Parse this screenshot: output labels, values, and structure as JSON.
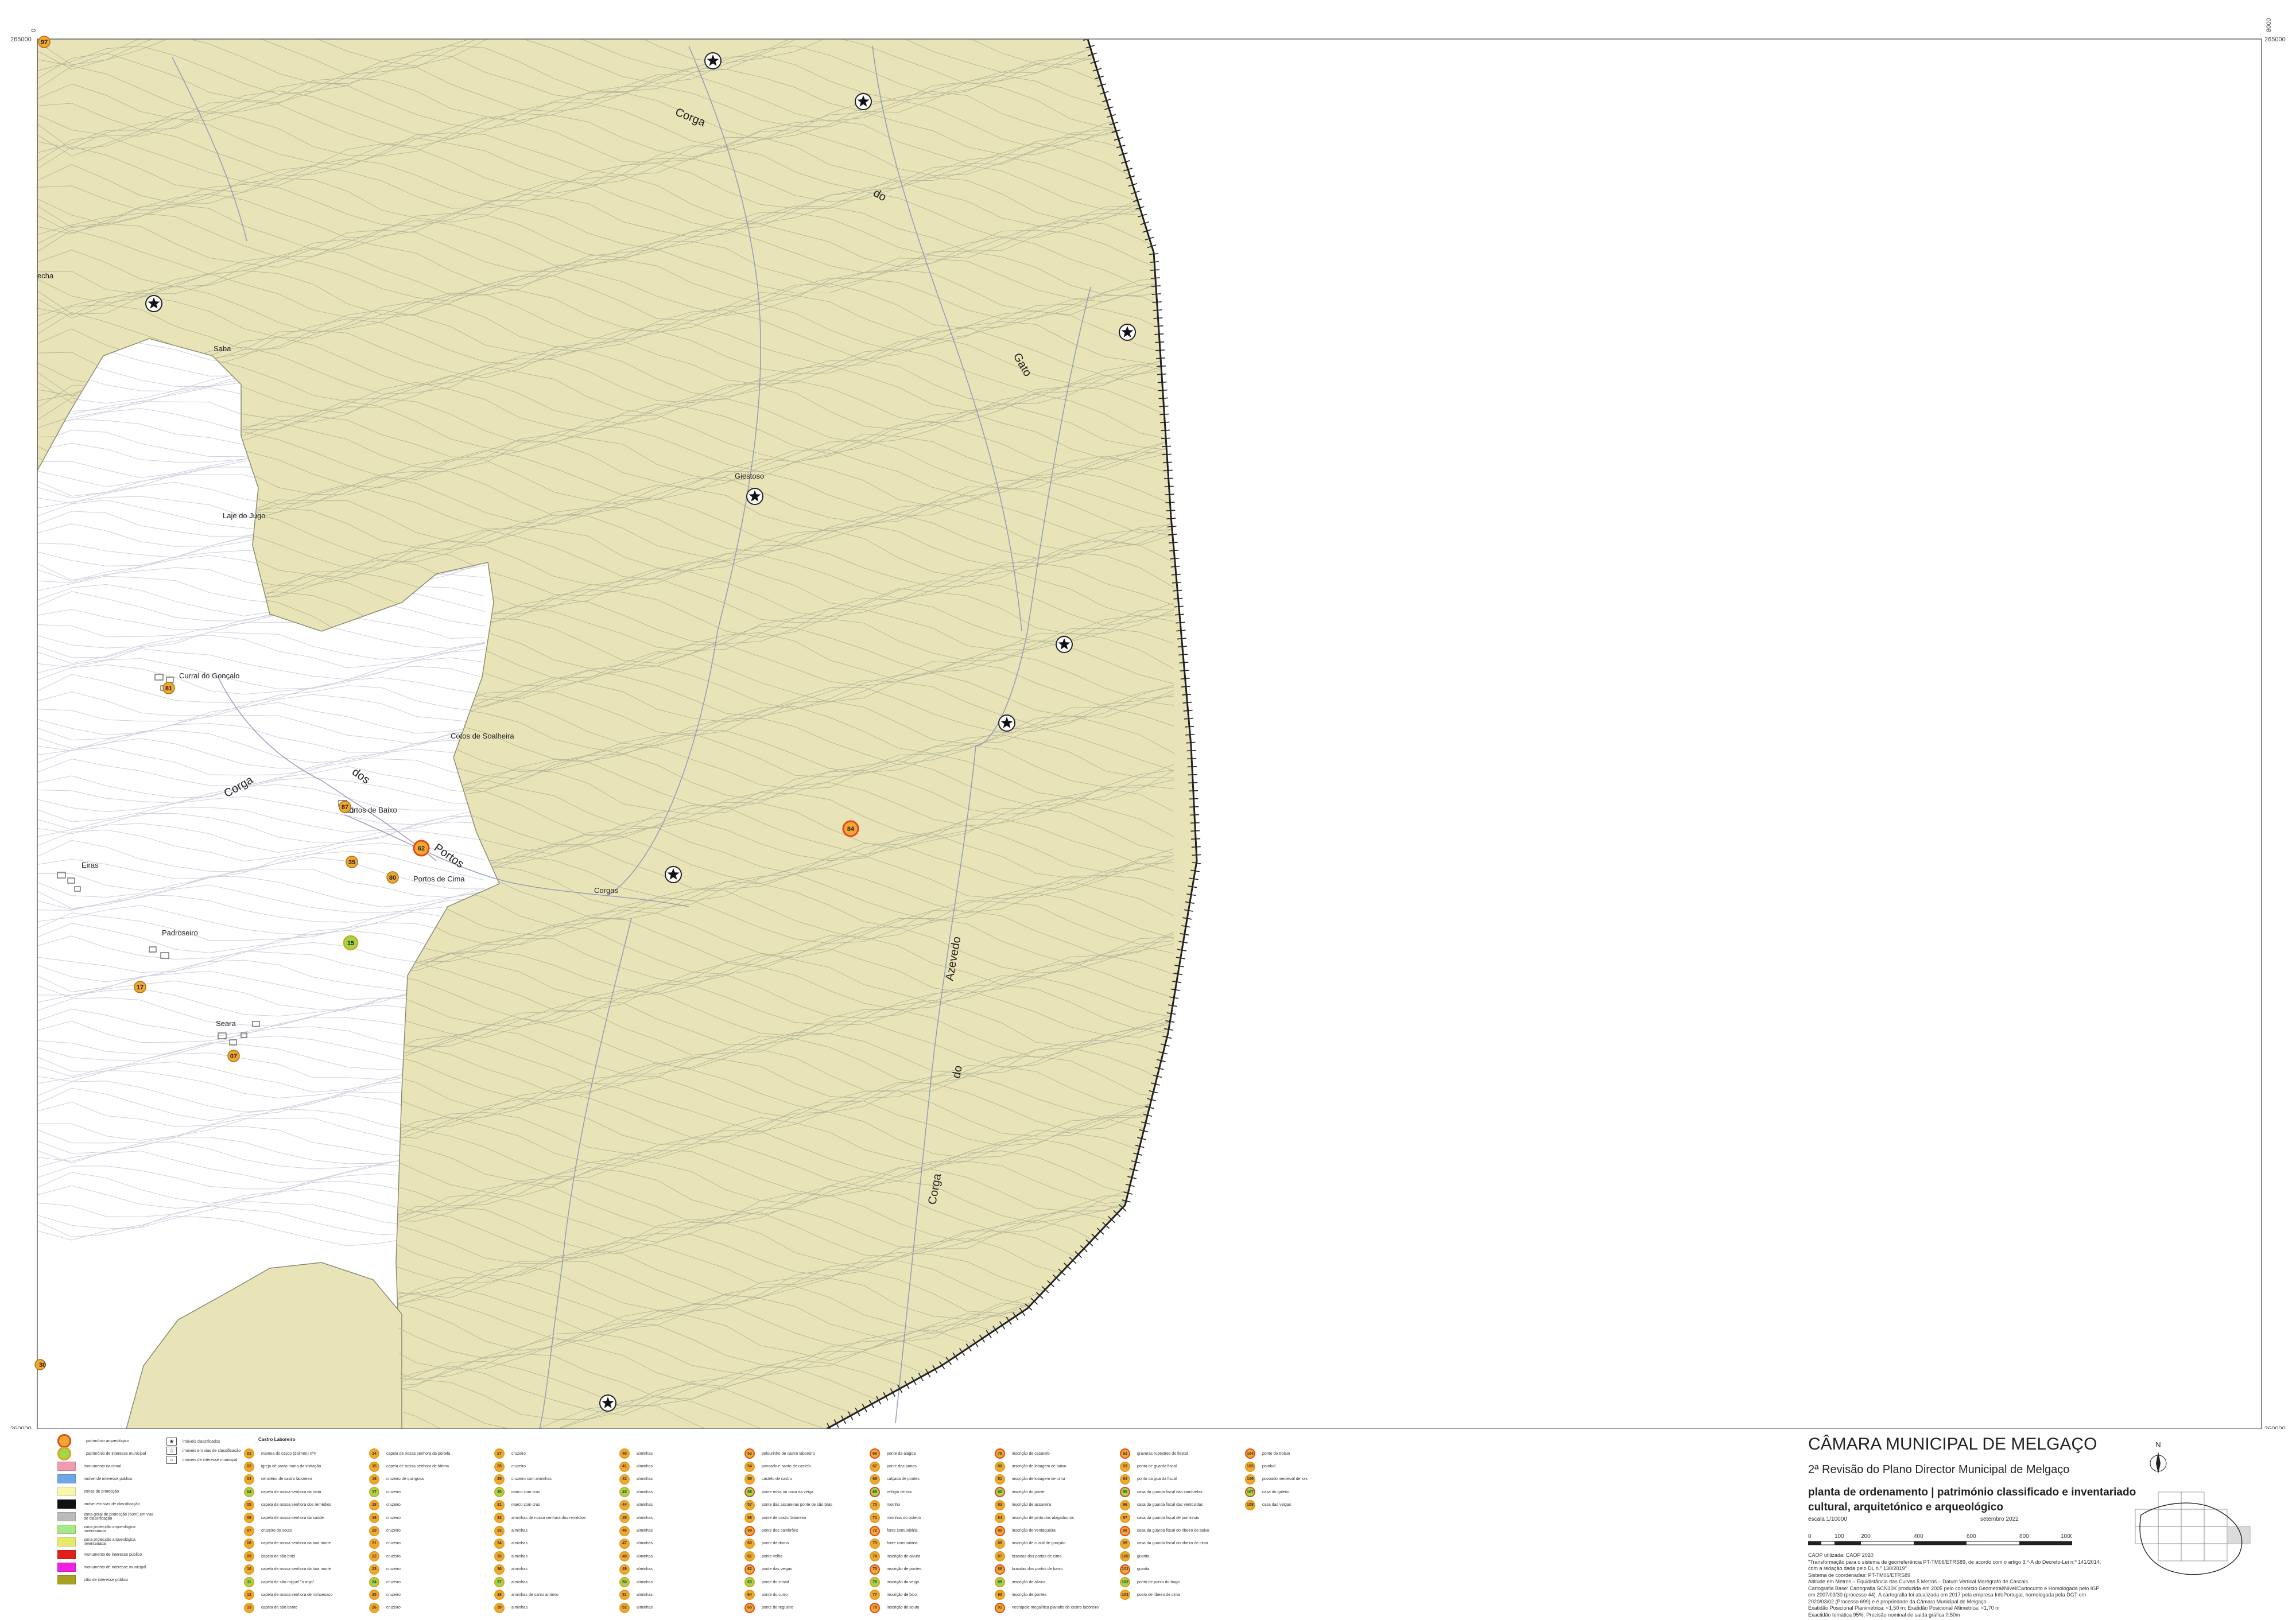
{
  "map": {
    "coords": {
      "top_left": "265000",
      "top_right": "265000",
      "bottom_left": "260000",
      "bottom_right": "260000",
      "top_small_left": "0",
      "top_small_right": "8000",
      "bottom_small_right": "8000"
    },
    "place_names": {
      "saba": "Saba",
      "lage_do_jugo": "Laje do Jugo",
      "giestoso": "Giestoso",
      "curral_goncalo": "Curral do Gonçalo",
      "cotos_soalheira": "Cotos de Soalheira",
      "portos_baixo": "Portos de Baixo",
      "portos_cima": "Portos de Cima",
      "eiras": "Eiras",
      "padroseiro": "Padroseiro",
      "seara": "Seara",
      "corgas": "Corgas",
      "echa": "echa"
    },
    "stream_names": {
      "corga_top": "Corga",
      "do_top": "do",
      "gato": "Gato",
      "corga_dos": "Corga",
      "dos": "dos",
      "portos": "Portos",
      "azevedo": "Azevedo",
      "do_bottom": "do",
      "corga_bottom": "Corga"
    },
    "poi_numbers": {
      "p97": "97",
      "p81": "81",
      "p87": "87",
      "p62": "62",
      "p84": "84",
      "p35": "35",
      "p80": "80",
      "p15": "15",
      "p17": "17",
      "p07": "07",
      "p30": "30"
    },
    "colors": {
      "zone_fill": "#e9e4b8",
      "contour": "#b7b89a",
      "border": "#222222",
      "poi_orange": "#f0a830",
      "poi_ring": "#e24a1a",
      "poi_green": "#9fd84a"
    }
  },
  "legend": {
    "left": [
      {
        "label": "património arqueológico",
        "color": "#f0a830",
        "shape": "circle"
      },
      {
        "label": "património de interesse municipal",
        "color": "#9fd84a",
        "shape": "circle"
      },
      {
        "label": "monumento nacional",
        "color": "#f29ab0",
        "shape": "rect"
      },
      {
        "label": "imóvel de interesse público",
        "color": "#6ea8e6",
        "shape": "rect"
      },
      {
        "label": "zonas de protecção",
        "color": "#f7f7b0",
        "shape": "rect"
      },
      {
        "label": "imóvel em vias de classificação",
        "color": "#111111",
        "shape": "rect"
      },
      {
        "label": "zona geral de protecção (50m) em vias de classificação",
        "color": "#bbbbbb",
        "shape": "rect"
      },
      {
        "label": "zona protecção arqueológica inventariada",
        "color": "#a8e68a",
        "shape": "rect"
      },
      {
        "label": "zona protecção arqueológica inventariada",
        "color": "#e8e86a",
        "shape": "rect"
      },
      {
        "label": "monumento de interesse público",
        "color": "#e0201a",
        "shape": "rect"
      },
      {
        "label": "monumento de interesse municipal",
        "color": "#f020e0",
        "shape": "rect"
      },
      {
        "label": "sítio de interesse público",
        "color": "#a8a020",
        "shape": "rect"
      }
    ],
    "small": [
      {
        "label": "imóveis classificados",
        "glyph": "★"
      },
      {
        "label": "imóveis em vias de classificação",
        "glyph": "☆"
      },
      {
        "label": "imóveis de interesse municipal",
        "glyph": "○"
      }
    ],
    "title": "Castro Laboreiro",
    "columns": [
      [
        {
          "n": "01",
          "t": "mamoa do casco (dolmen) nº4"
        },
        {
          "n": "02",
          "t": "igreja de santa maria da visitação"
        },
        {
          "n": "03",
          "t": "cemitério de castro laboreiro"
        },
        {
          "n": "04",
          "t": "capela de nossa senhora da vista"
        },
        {
          "n": "05",
          "t": "capela de nossa senhora dos remédios"
        },
        {
          "n": "06",
          "t": "capela de nossa senhora da saúde"
        },
        {
          "n": "07",
          "t": "cruzeiro do souto"
        },
        {
          "n": "08",
          "t": "capela de nossa senhora da boa morte"
        },
        {
          "n": "09",
          "t": "capela de são brás"
        },
        {
          "n": "10",
          "t": "capela de nossa senhora da boa morte"
        },
        {
          "n": "11",
          "t": "capela de são miguel \"o anjo\""
        },
        {
          "n": "12",
          "t": "capela de nossa senhora de rompesaco"
        },
        {
          "n": "13",
          "t": "capela de são bento"
        }
      ],
      [
        {
          "n": "14",
          "t": "capela de nossa senhora da portela"
        },
        {
          "n": "15",
          "t": "capela de nossa senhora de fátima"
        },
        {
          "n": "16",
          "t": "cruzeiro de quingosa"
        },
        {
          "n": "17",
          "t": "cruzeiro"
        },
        {
          "n": "18",
          "t": "cruzeiro"
        },
        {
          "n": "19",
          "t": "cruzeiro"
        },
        {
          "n": "20",
          "t": "cruzeiro"
        },
        {
          "n": "21",
          "t": "cruzeiro"
        },
        {
          "n": "22",
          "t": "cruzeiro"
        },
        {
          "n": "23",
          "t": "cruzeiro"
        },
        {
          "n": "24",
          "t": "cruzeiro"
        },
        {
          "n": "25",
          "t": "cruzeiro"
        },
        {
          "n": "26",
          "t": "cruzeiro"
        }
      ],
      [
        {
          "n": "27",
          "t": "cruzeiro"
        },
        {
          "n": "28",
          "t": "cruzeiro"
        },
        {
          "n": "29",
          "t": "cruzeiro com alminhas"
        },
        {
          "n": "30",
          "t": "marco com cruz"
        },
        {
          "n": "31",
          "t": "marco com cruz"
        },
        {
          "n": "32",
          "t": "alminhas de nossa senhora dos remédios"
        },
        {
          "n": "33",
          "t": "alminhas"
        },
        {
          "n": "34",
          "t": "alminhas"
        },
        {
          "n": "35",
          "t": "alminhas"
        },
        {
          "n": "36",
          "t": "alminhas"
        },
        {
          "n": "37",
          "t": "alminhas"
        },
        {
          "n": "38",
          "t": "alminhas de santo antónio"
        },
        {
          "n": "39",
          "t": "alminhas"
        }
      ],
      [
        {
          "n": "40",
          "t": "alminhas"
        },
        {
          "n": "41",
          "t": "alminhas"
        },
        {
          "n": "42",
          "t": "alminhas"
        },
        {
          "n": "43",
          "t": "alminhas"
        },
        {
          "n": "44",
          "t": "alminhas"
        },
        {
          "n": "45",
          "t": "alminhas"
        },
        {
          "n": "46",
          "t": "alminhas"
        },
        {
          "n": "47",
          "t": "alminhas"
        },
        {
          "n": "48",
          "t": "alminhas"
        },
        {
          "n": "49",
          "t": "alminhas"
        },
        {
          "n": "50",
          "t": "alminhas"
        },
        {
          "n": "51",
          "t": "alminhas"
        },
        {
          "n": "52",
          "t": "alminhas"
        }
      ],
      [
        {
          "n": "53",
          "t": "pelourinho de castro laboreiro"
        },
        {
          "n": "54",
          "t": "povoado e santo de castelo"
        },
        {
          "n": "55",
          "t": "castelo de castro"
        },
        {
          "n": "56",
          "t": "ponte nova ou nova da veiga"
        },
        {
          "n": "57",
          "t": "ponte das assureiras ponte de são brás"
        },
        {
          "n": "58",
          "t": "ponte de castro laboreiro"
        },
        {
          "n": "59",
          "t": "ponte dos cambrões"
        },
        {
          "n": "60",
          "t": "ponte da dorna"
        },
        {
          "n": "61",
          "t": "ponte velha"
        },
        {
          "n": "62",
          "t": "ponte das veigas"
        },
        {
          "n": "63",
          "t": "ponte do cristal"
        },
        {
          "n": "64",
          "t": "ponte do curro"
        },
        {
          "n": "65",
          "t": "ponte do regueiro"
        }
      ],
      [
        {
          "n": "66",
          "t": "ponte da alagoa"
        },
        {
          "n": "67",
          "t": "ponte das porias"
        },
        {
          "n": "68",
          "t": "calçada de pontes"
        },
        {
          "n": "69",
          "t": "refúgio de xxx"
        },
        {
          "n": "70",
          "t": "moinho"
        },
        {
          "n": "71",
          "t": "moinhos do outeiro"
        },
        {
          "n": "72",
          "t": "fonte comunitária"
        },
        {
          "n": "73",
          "t": "fonte comunitária"
        },
        {
          "n": "74",
          "t": "inscrição de alvura"
        },
        {
          "n": "75",
          "t": "inscrição de pontes"
        },
        {
          "n": "76",
          "t": "inscrição da veiga"
        },
        {
          "n": "77",
          "t": "inscrição de bico"
        },
        {
          "n": "78",
          "t": "inscrição do souto"
        }
      ],
      [
        {
          "n": "79",
          "t": "inscrição de casarelo"
        },
        {
          "n": "80",
          "t": "inscrição de lobagem de baixo"
        },
        {
          "n": "81",
          "t": "inscrição de lobagem de cima"
        },
        {
          "n": "82",
          "t": "inscrição do ponte"
        },
        {
          "n": "83",
          "t": "inscrição de assureira"
        },
        {
          "n": "84",
          "t": "inscrição de pinto dos alagadouros"
        },
        {
          "n": "85",
          "t": "inscrição de ventaqueira"
        },
        {
          "n": "86",
          "t": "inscrição de curral de gonçalo"
        },
        {
          "n": "87",
          "t": "brandas dos portos de cima"
        },
        {
          "n": "88",
          "t": "brandas dos portos de baixo"
        },
        {
          "n": "89",
          "t": "inscrição de alvura"
        },
        {
          "n": "90",
          "t": "inscrição de pontes"
        },
        {
          "n": "91",
          "t": "necrópole megalítica planalto de castro laboreiro"
        }
      ],
      [
        {
          "n": "92",
          "t": "gravuras rupestres do fiestal"
        },
        {
          "n": "93",
          "t": "ponto de guarda fiscal"
        },
        {
          "n": "94",
          "t": "ponto da guarda fiscal"
        },
        {
          "n": "95",
          "t": "casa da guarda fiscal das cambrelas"
        },
        {
          "n": "96",
          "t": "casa da guarda fiscal das ventosidas"
        },
        {
          "n": "97",
          "t": "casa da guarda fiscal de pontinhas"
        },
        {
          "n": "98",
          "t": "casa da guarda fiscal do ribeiro de baixo"
        },
        {
          "n": "99",
          "t": "casa da guarda fiscal do ribeiro de cima"
        },
        {
          "n": "100",
          "t": "guarita"
        },
        {
          "n": "101",
          "t": "guarita"
        },
        {
          "n": "102",
          "t": "ponto de ponto do bago"
        },
        {
          "n": "103",
          "t": "posto de ribeiro de cima"
        }
      ],
      [
        {
          "n": "104",
          "t": "ponto do trolaio"
        },
        {
          "n": "105",
          "t": "pombal"
        },
        {
          "n": "106",
          "t": "povoado medieval de xxx"
        },
        {
          "n": "107",
          "t": "casa do galeiro"
        },
        {
          "n": "108",
          "t": "casa das veigas"
        }
      ]
    ]
  },
  "titleblock": {
    "org": "CÂMARA MUNICIPAL DE MELGAÇO",
    "subtitle": "2ª Revisão do Plano Director Municipal de Melgaço",
    "title": "planta de ordenamento | património classificado e inventariado cultural, arquitetónico e arqueológico",
    "scale_label": "escala 1/10000",
    "date": "setembro 2022",
    "north": "N",
    "scale_ticks": [
      "0",
      "100",
      "200",
      "400",
      "600",
      "800",
      "1000m"
    ],
    "notes": [
      "CAOP utilizada: CAOP 2020",
      "\"Transformação para o sistema de georreferência PT-TM06/ETRS89, de acordo com o artigo 3.º-A do Decreto-Lei n.º 141/2014, com a redação dada pelo DL n.º 130/2019\"",
      "Sistema de coordenadas: PT-TM06/ETRS89",
      "Altitude em Metros – Equidistância das Curvas 5 Metros – Datum Vertical Marégrafo de Cascais",
      "Cartografia Base: Cartografia SCN10K produzida em 2005 pelo consórcio Geometral/Nível/Cartocunto e Homologada pelo IGP em 2007/03/30 (processo 44). A cartografia foi atualizada em 2017 pela empresa InfoPortugal, homologada pela DGT em 2020/03/02 (Processo 699) e é propriedade da Câmara Municipal de Melgaço",
      "Exatidão Posicional Planimétrica: <1,50 m; Exatidão Posicional Altimétrica: <1,70 m",
      "Exactidão temática 95%; Precisão nominal de saída gráfica 0,50m"
    ]
  }
}
